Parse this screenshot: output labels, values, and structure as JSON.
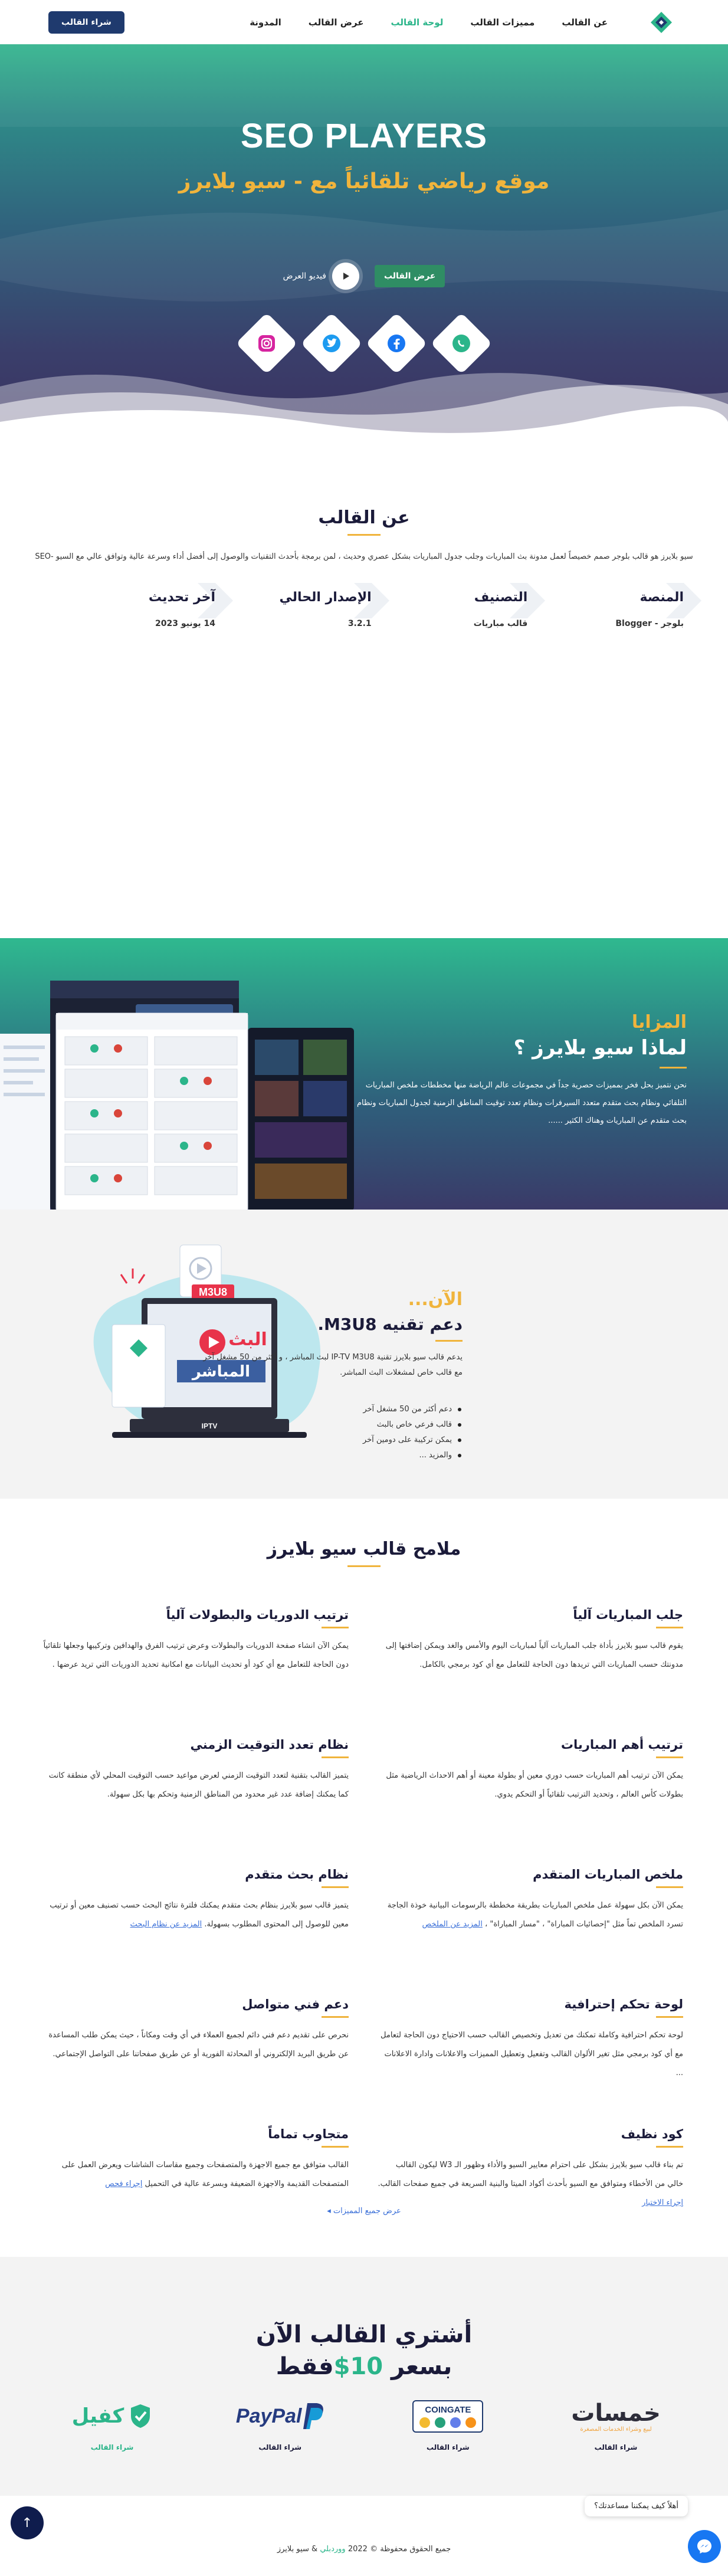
{
  "nav": {
    "items": [
      "عن القالب",
      "مميزات القالب",
      "لوحة القالب",
      "عرض القالب",
      "المدونة"
    ],
    "active_index": 2,
    "buy_label": "شراء القالب"
  },
  "hero": {
    "title": "SEO PLAYERS",
    "subtitle": "موقع رياضي تلقائياً مع - سيو بلايرز",
    "demo_label": "عرض القالب",
    "video_label": "فيديو العرض",
    "socials": [
      "whatsapp-icon",
      "facebook-icon",
      "twitter-icon",
      "instagram-icon"
    ]
  },
  "about": {
    "heading": "عن القالب",
    "text": "سيو بلايرز هو قالب بلوجر صمم خصيصاً لعمل مدونة بث المباريات وجلب جدول المباريات بشكل عصري وحديث ، لمن برمجة بأحدث التقنيات والوصول إلى أفضل أداء وسرعة عالية وتوافق عالي مع السيو -SEO",
    "specs": [
      {
        "label": "المنصة",
        "value": "بلوجر - Blogger"
      },
      {
        "label": "التصنيف",
        "value": "قالب مباريات"
      },
      {
        "label": "الإصدار الحالي",
        "value": "3.2.1"
      },
      {
        "label": "آخر تحديث",
        "value": "14 يونيو 2023"
      }
    ]
  },
  "why": {
    "tag": "المزايا",
    "heading": "لماذا سيو بلايرز ؟",
    "text": "نحن نتميز بحل فخر بمميزات حصرية جداً في مجموعات عالم الرياضة منها مخططات ملخص المباريات التلقائي ونظام بحث متقدم متعدد السيرفرات ونظام تعدد توقيت المناطق الزمنية لجدول المباريات ونظام بحث متقدم عن المباريات وهناك الكثير ......"
  },
  "m3u8": {
    "tag": "الآن...",
    "heading": "دعم تقنيه M3U8.",
    "text": "يدعم قالب سيو بلايرز تقنية IP-TV M3U8 لبث المباشر ، و أكثر من 50 مشغل آخر مع قالب خاص لمشغلات البث المباشر.",
    "list": [
      "دعم أكثر من 50 مشغل آخر",
      "قالب فرعي خاص بالبث",
      "يمكن تركيبة على دومين آخر",
      "والمزيد ..."
    ],
    "art_word1": "البث",
    "art_word2": "المباشر",
    "art_badge": "M3U8",
    "art_iptv": "IPTV"
  },
  "features": {
    "heading": "ملامح قالب سيو بلايرز",
    "items": [
      {
        "title": "جلب المباريات آلياً",
        "text": "يقوم قالب سيو بلايرز بأداة جلب المباريات آلياً لمباريات اليوم والأمس والغد ويمكن إضافتها إلى مدونتك حسب المباريات التي تريدها دون الحاجة للتعامل مع أي كود برمجي بالكامل."
      },
      {
        "title": "ترتيب الدوريات والبطولات آلياً",
        "text": "يمكن الآن انشاء صفحة الدوريات والبطولات وعرض ترتيب الفرق والهدافين وتركيبها وجعلها تلقائياً دون الحاجة للتعامل مع أي كود أو تحديث البيانات مع امكانية تحديد الدوريات التي تريد عرضها ."
      },
      {
        "title": "ترتيب أهم المباريات",
        "text": "يمكن الآن ترتيب أهم المباريات حسب دوري معين أو بطولة معينة أو أهم الاحداث الرياضية مثل بطولات كأس العالم ، وتحديد الترتيب تلقائياً أو التحكم يدوي."
      },
      {
        "title": "نظام تعدد التوقيت الزمني",
        "text": "يتميز القالب بتقنية لتعدد التوقيت الزمني لعرض مواعيد حسب التوقيت المحلي لأي منطقة كانت كما يمكنك إضافة عدد غير محدود من المناطق الزمنية وتحكم بها بكل سهولة."
      },
      {
        "title": "ملخص المباريات المتقدم",
        "text": "يمكن الآن بكل سهولة عمل ملخص المباريات بطريقة مخططة بالرسومات البيانية خوذة الجاجة تسرد الملخص تماً مثل \"إحصائيات المباراة\" ، \"مسار المباراة\" ،",
        "more": "المزيد عن الملخص"
      },
      {
        "title": "نظام بحث متقدم",
        "text": "يتميز قالب سيو بلايرز بنظام بحث متقدم يمكنك فلترة نتائج البحث حسب تصنيف معين أو ترتيب معين للوصول إلى المحتوى المطلوب بسهولة.",
        "more": "المزيد عن نظام البحث"
      },
      {
        "title": "لوحة تحكم إحترافية",
        "text": "لوحة تحكم احترافية وكاملة تمكنك من تعديل وتخصيص القالب حسب الاحتياج دون الحاجة لتعامل مع أي كود برمجي مثل تغير الألوان القالب وتفعيل وتعطيل المميزات والاعلانات وادارة الاعلانات ..."
      },
      {
        "title": "دعم فني متواصل",
        "text": "نحرص على تقديم دعم فني دائم لجميع العملاء في أي وقت ومكاناً ، حيث يمكن طلب المساعدة عن طريق البريد الإلكتروني أو المحادثة الفورية أو عن طريق صفحاتنا على التواصل الإجتماعي."
      },
      {
        "title": "كود نظيف",
        "text": "تم بناء قالب سيو بلايرز بشكل على احترام معايير السيو والأداء وظهور الـ W3 ليكون القالب خالي من الأخطاء ومتوافق مع السيو بأحدث أكواد الميتا والبنية السريعة في جميع صفحات القالب.",
        "more": "إجراء الاختبار"
      },
      {
        "title": "متجاوب تماماً",
        "text": "القالب متوافق مع جميع الاجهزة والمتصفحات وجميع مقاسات الشاشات ويعرض العمل على المتصفحات القديمة والاجهزة الضعيفة وبسرعة عالية في التحميل",
        "more": "إجراء فحص"
      }
    ],
    "all_label": "عرض جميع المميزات"
  },
  "buy": {
    "line1": "أشتري القالب الآن",
    "line2_pre": "بسعر ",
    "price": "10$",
    "line2_post": "فقط",
    "vendors": [
      {
        "name": "خمسات",
        "sub": "لبيع وشراء الخدمات المصغرة",
        "cap": "شراء القالب"
      },
      {
        "name": "COINGATE",
        "sub": "",
        "cap": "شراء القالب"
      },
      {
        "name": "PayPal",
        "sub": "",
        "cap": "شراء القالب"
      },
      {
        "name": "كفيل",
        "sub": "",
        "cap": "شراء القالب"
      }
    ]
  },
  "footer": {
    "copy_pre": "جميع الحقوق محفوظة © 2022 ",
    "copy_link": "ووردبلي",
    "copy_post": " & سيو بلايرز",
    "chat_text": "أهلاً كيف يمكننا مساعدتك؟"
  },
  "colors": {
    "accent": "#2bb58a",
    "gold": "#f0b43c",
    "navy": "#1b1b3a",
    "button": "#1f3a6e"
  }
}
